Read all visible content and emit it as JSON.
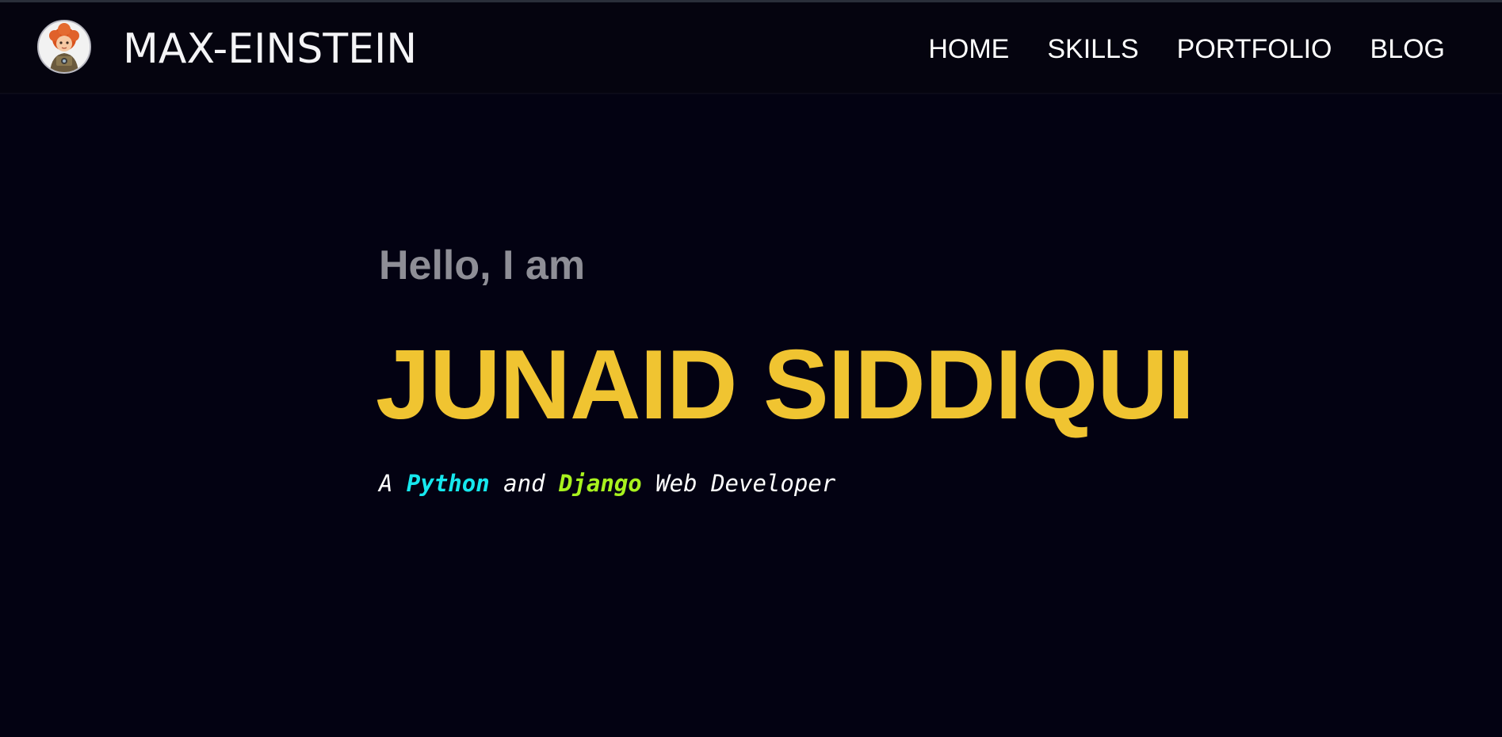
{
  "header": {
    "brand": "MAX-EINSTEIN",
    "nav": [
      {
        "label": "HOME"
      },
      {
        "label": "SKILLS"
      },
      {
        "label": "PORTFOLIO"
      },
      {
        "label": "BLOG"
      }
    ]
  },
  "hero": {
    "greeting": "Hello, I am",
    "name": "JUNAID SIDDIQUI",
    "tagline": {
      "prefix": "A ",
      "highlight1": "Python",
      "middle": " and ",
      "highlight2": "Django",
      "suffix": " Web Developer"
    }
  },
  "colors": {
    "background": "#030212",
    "navbar": "#05040f",
    "name": "#f0c431",
    "greeting": "#8e8e96",
    "python": "#16e8ee",
    "django": "#a8f21e"
  },
  "icons": {
    "avatar": "cartoon-avatar-icon"
  }
}
